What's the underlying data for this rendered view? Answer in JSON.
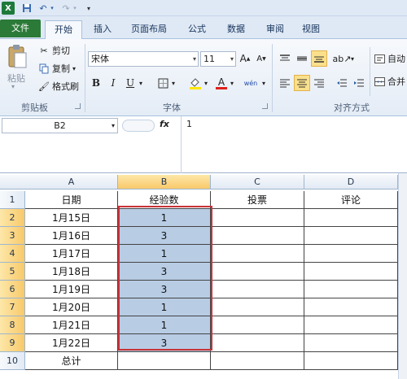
{
  "tabs": {
    "file": "文件",
    "home": "开始",
    "insert": "插入",
    "page_layout": "页面布局",
    "formulas": "公式",
    "data": "数据",
    "review": "审阅",
    "view": "视图"
  },
  "clipboard": {
    "paste": "粘贴",
    "cut": "剪切",
    "copy": "复制",
    "format_painter": "格式刷",
    "group_label": "剪贴板"
  },
  "font": {
    "name": "宋体",
    "size": "11",
    "bold": "B",
    "italic": "I",
    "underline": "U",
    "font_color_label": "A",
    "phonetic_label": "wén",
    "grow_label": "A",
    "shrink_label": "A",
    "group_label": "字体"
  },
  "alignment": {
    "wrap_text": "自动",
    "merge": "合并",
    "group_label": "对齐方式"
  },
  "formula_bar": {
    "name_box": "B2",
    "fx": "fx",
    "content": "1"
  },
  "columns": [
    "A",
    "B",
    "C",
    "D"
  ],
  "rows": [
    "1",
    "2",
    "3",
    "4",
    "5",
    "6",
    "7",
    "8",
    "9",
    "10"
  ],
  "table": [
    [
      "日期",
      "经验数",
      "投票",
      "评论"
    ],
    [
      "1月15日",
      "1",
      "",
      ""
    ],
    [
      "1月16日",
      "3",
      "",
      ""
    ],
    [
      "1月17日",
      "1",
      "",
      ""
    ],
    [
      "1月18日",
      "3",
      "",
      ""
    ],
    [
      "1月19日",
      "3",
      "",
      ""
    ],
    [
      "1月20日",
      "1",
      "",
      ""
    ],
    [
      "1月21日",
      "1",
      "",
      ""
    ],
    [
      "1月22日",
      "3",
      "",
      ""
    ],
    [
      "总计",
      "",
      "",
      ""
    ]
  ],
  "colors": {
    "selection_fill": "#b8cce4",
    "selection_border": "#c83237",
    "file_tab": "#2b7a37"
  }
}
